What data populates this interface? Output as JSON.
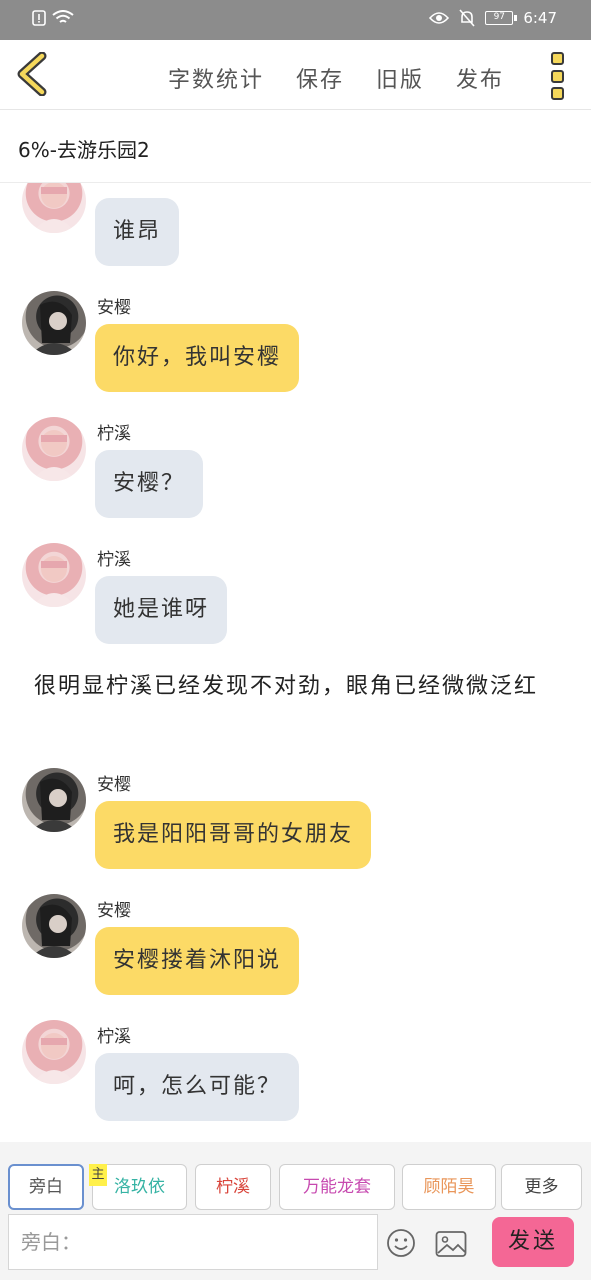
{
  "status_bar": {
    "time": "6:47",
    "battery": "97"
  },
  "toolbar": {
    "word_count": "字数统计",
    "save": "保存",
    "old_version": "旧版",
    "publish": "发布"
  },
  "chapter_title": "6%-去游乐园2",
  "messages": [
    {
      "speaker": "",
      "text": "谁昂",
      "style": "gray",
      "avatar": "pink"
    },
    {
      "speaker": "安樱",
      "text": "你好，我叫安樱",
      "style": "yellow",
      "avatar": "dark"
    },
    {
      "speaker": "柠溪",
      "text": "安樱？",
      "style": "gray",
      "avatar": "pink"
    },
    {
      "speaker": "柠溪",
      "text": "她是谁呀",
      "style": "gray",
      "avatar": "pink"
    },
    {
      "speaker": "安樱",
      "text": "我是阳阳哥哥的女朋友",
      "style": "yellow",
      "avatar": "dark"
    },
    {
      "speaker": "安樱",
      "text": "安樱搂着沐阳说",
      "style": "yellow",
      "avatar": "dark"
    },
    {
      "speaker": "柠溪",
      "text": "呵，怎么可能？",
      "style": "gray",
      "avatar": "pink"
    }
  ],
  "narration": "很明显柠溪已经发现不对劲，眼角已经微微泛红",
  "roles": [
    {
      "label": "旁白",
      "color": "#555555"
    },
    {
      "label": "洛玖依",
      "color": "#36b3a4"
    },
    {
      "label": "柠溪",
      "color": "#d9453b"
    },
    {
      "label": "万能龙套",
      "color": "#c74ab0"
    },
    {
      "label": "顾陌昊",
      "color": "#e9965a"
    },
    {
      "label": "更多",
      "color": "#444444"
    }
  ],
  "main_tag": "主",
  "input": {
    "placeholder": "旁白："
  },
  "send_label": "发送"
}
